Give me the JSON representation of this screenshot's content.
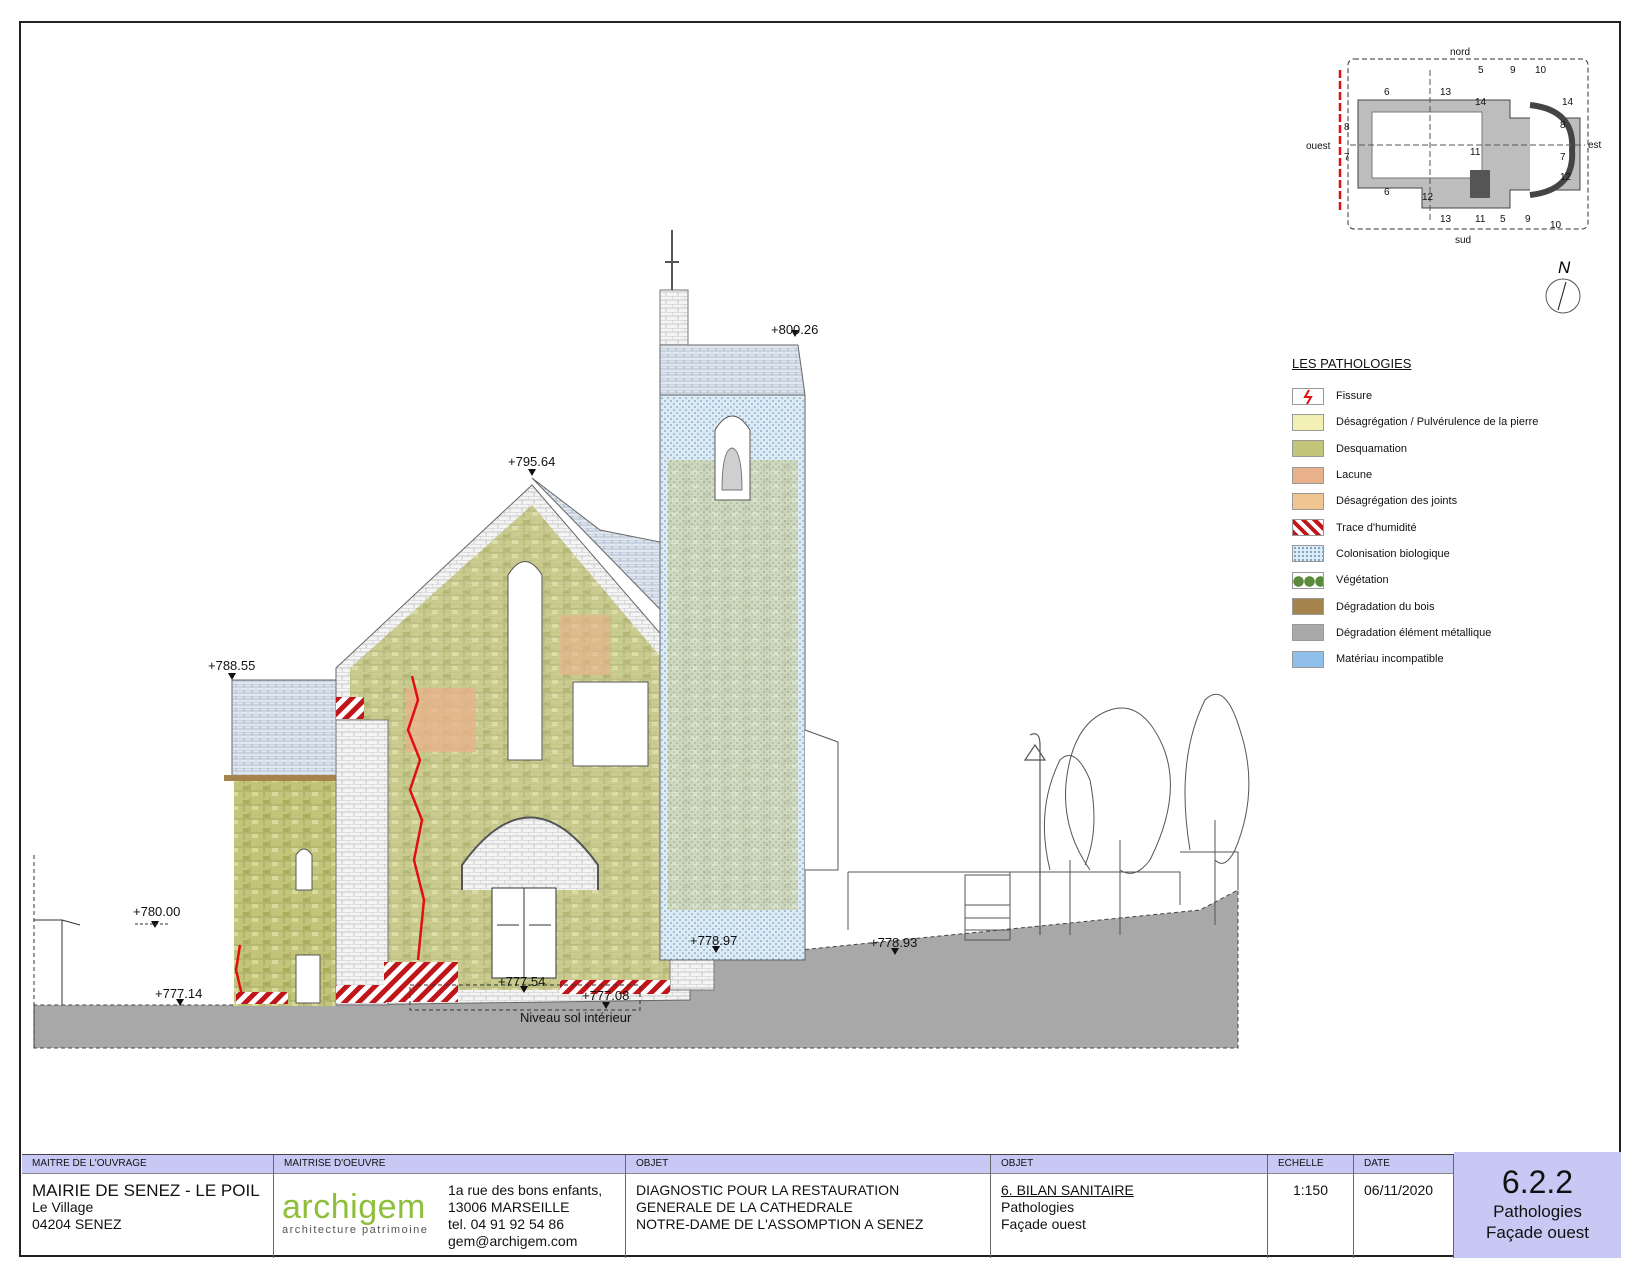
{
  "levels": {
    "top_tower": "+800.26",
    "gable": "+795.64",
    "left_roof": "+788.55",
    "left_ground_high": "+780.00",
    "left_ground": "+777.14",
    "door": "+777.54",
    "interior": "+777.08",
    "right_step": "+778.97",
    "right_ground": "+778.93"
  },
  "floor_label": "Niveau sol intérieur",
  "key_plan": {
    "north": "nord",
    "south": "sud",
    "east": "est",
    "west": "ouest",
    "north_symbol": "N",
    "section_numbers": [
      "5",
      "9",
      "10",
      "6",
      "13",
      "14",
      "14",
      "8",
      "7",
      "11",
      "12",
      "6",
      "13",
      "11",
      "5",
      "9",
      "10",
      "12",
      "8",
      "7"
    ]
  },
  "legend": {
    "title": "LES PATHOLOGIES",
    "items": [
      {
        "label": "Fissure",
        "color": "#ffffff",
        "pattern": "fissure"
      },
      {
        "label": "Désagrégation / Pulvérulence de la pierre",
        "color": "#f3f0b6",
        "pattern": "solid"
      },
      {
        "label": "Desquamation",
        "color": "#c2c47a",
        "pattern": "solid"
      },
      {
        "label": "Lacune",
        "color": "#e9b08c",
        "pattern": "solid"
      },
      {
        "label": "Désagrégation des joints",
        "color": "#f0c592",
        "pattern": "solid"
      },
      {
        "label": "Trace d'humidité",
        "color": "#c0161b",
        "pattern": "hatch"
      },
      {
        "label": "Colonisation biologique",
        "color": "#dcebf4",
        "pattern": "dots"
      },
      {
        "label": "Végétation",
        "color": "#5b8a3a",
        "pattern": "circles"
      },
      {
        "label": "Dégradation du bois",
        "color": "#a5834c",
        "pattern": "solid"
      },
      {
        "label": "Dégradation élément métallique",
        "color": "#a9a9a9",
        "pattern": "solid"
      },
      {
        "label": "Matériau incompatible",
        "color": "#8fbfea",
        "pattern": "solid"
      }
    ]
  },
  "title_block": {
    "owner": {
      "head": "MAITRE DE L'OUVRAGE",
      "name": "MAIRIE DE SENEZ - LE POIL",
      "line1": "Le Village",
      "line2": "04204 SENEZ"
    },
    "architect": {
      "head": "MAITRISE D'OEUVRE",
      "logo": "archigem",
      "logo_sub": "architecture patrimoine",
      "addr1": "1a rue des bons enfants,",
      "addr2": "13006 MARSEILLE",
      "tel": "tel. 04 91 92 54 86",
      "email": "gem@archigem.com"
    },
    "object1": {
      "head": "OBJET",
      "line1": "DIAGNOSTIC POUR LA RESTAURATION",
      "line2": "GENERALE DE LA CATHEDRALE",
      "line3": "NOTRE-DAME DE L'ASSOMPTION A SENEZ"
    },
    "object2": {
      "head": "OBJET",
      "line1": "6. BILAN SANITAIRE",
      "line2": "Pathologies",
      "line3": "Façade ouest"
    },
    "scale": {
      "head": "ECHELLE",
      "value": "1:150"
    },
    "date": {
      "head": "DATE",
      "value": "06/11/2020"
    },
    "sheet": {
      "number": "6.2.2",
      "line1": "Pathologies",
      "line2": "Façade ouest"
    }
  }
}
